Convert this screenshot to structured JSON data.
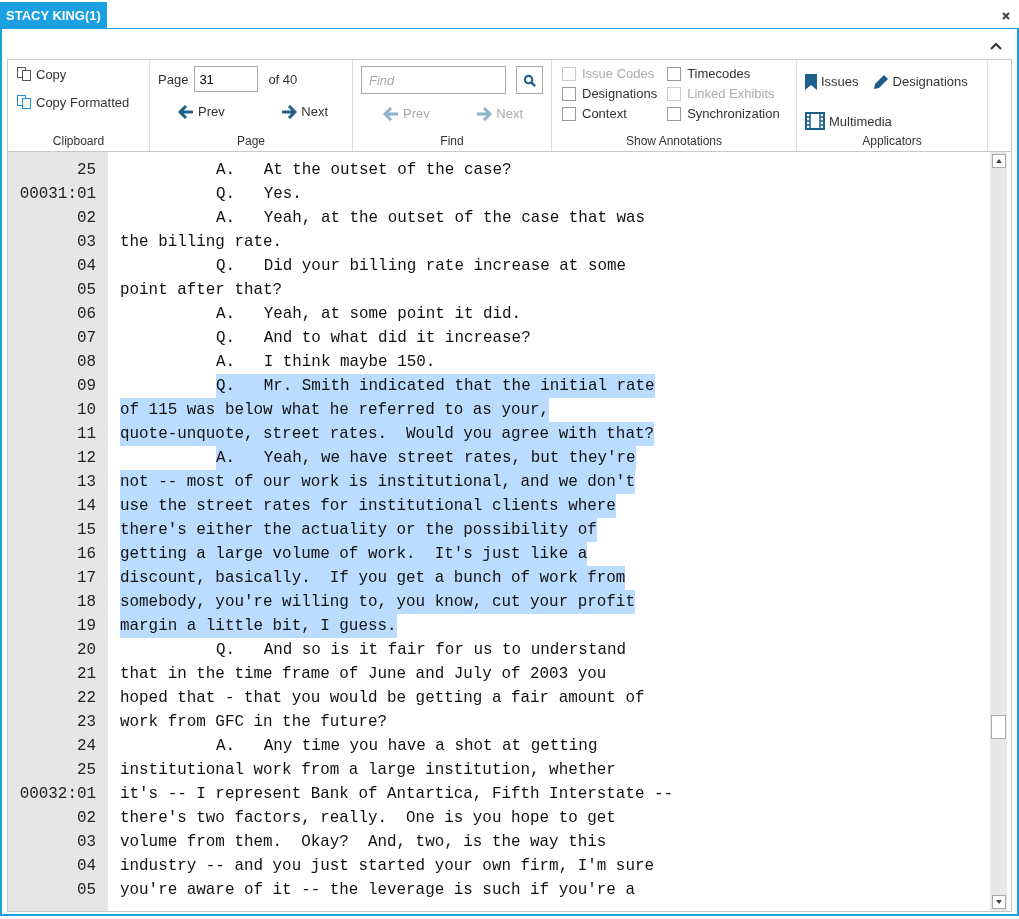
{
  "tab": {
    "label": "STACY KING(1)",
    "selected": true
  },
  "ribbon": {
    "clipboard": {
      "buttons": [
        "Copy",
        "Copy Formatted"
      ],
      "label": "Clipboard"
    },
    "page": {
      "prefix": "Page",
      "value": "31",
      "suffix": "of 40",
      "prev": "Prev",
      "next": "Next",
      "label": "Page"
    },
    "find": {
      "placeholder": "Find",
      "prev": {
        "label": "Prev",
        "disabled": true
      },
      "next": {
        "label": "Next",
        "disabled": true
      },
      "label": "Find"
    },
    "annotations": {
      "label": "Show Annotations",
      "columns": [
        [
          {
            "label": "Issue Codes",
            "checked": false,
            "disabled": true
          },
          {
            "label": "Designations",
            "checked": false,
            "disabled": false
          },
          {
            "label": "Context",
            "checked": false,
            "disabled": false
          }
        ],
        [
          {
            "label": "Timecodes",
            "checked": false,
            "disabled": false
          },
          {
            "label": "Linked Exhibits",
            "checked": false,
            "disabled": true
          },
          {
            "label": "Synchronization",
            "checked": false,
            "disabled": false
          }
        ]
      ]
    },
    "applicators": {
      "label": "Applicators",
      "items": [
        {
          "kind": "issues",
          "label": "Issues"
        },
        {
          "kind": "designations",
          "label": "Designations"
        },
        {
          "kind": "multimedia",
          "label": "Multimedia"
        }
      ]
    }
  },
  "transcript": [
    {
      "number": "25",
      "text": "A.   At the outset of the case?",
      "indented": true,
      "highlighted": false
    },
    {
      "number": "00031:01",
      "text": "Q.   Yes.",
      "indented": true,
      "highlighted": false
    },
    {
      "number": "02",
      "text": "A.   Yeah, at the outset of the case that was",
      "indented": true,
      "highlighted": false
    },
    {
      "number": "03",
      "text": "the billing rate.",
      "indented": false,
      "highlighted": false
    },
    {
      "number": "04",
      "text": "Q.   Did your billing rate increase at some",
      "indented": true,
      "highlighted": false
    },
    {
      "number": "05",
      "text": "point after that?",
      "indented": false,
      "highlighted": false
    },
    {
      "number": "06",
      "text": "A.   Yeah, at some point it did.",
      "indented": true,
      "highlighted": false
    },
    {
      "number": "07",
      "text": "Q.   And to what did it increase?",
      "indented": true,
      "highlighted": false
    },
    {
      "number": "08",
      "text": "A.   I think maybe 150.",
      "indented": true,
      "highlighted": false
    },
    {
      "number": "09",
      "text": "Q.   Mr. Smith indicated that the initial rate",
      "indented": true,
      "highlighted": true
    },
    {
      "number": "10",
      "text": "of 115 was below what he referred to as your,",
      "indented": false,
      "highlighted": true
    },
    {
      "number": "11",
      "text": "quote-unquote, street rates.  Would you agree with that?",
      "indented": false,
      "highlighted": true
    },
    {
      "number": "12",
      "text": "A.   Yeah, we have street rates, but they're",
      "indented": true,
      "highlighted": true
    },
    {
      "number": "13",
      "text": "not -- most of our work is institutional, and we don't",
      "indented": false,
      "highlighted": true
    },
    {
      "number": "14",
      "text": "use the street rates for institutional clients where",
      "indented": false,
      "highlighted": true
    },
    {
      "number": "15",
      "text": "there's either the actuality or the possibility of",
      "indented": false,
      "highlighted": true
    },
    {
      "number": "16",
      "text": "getting a large volume of work.  It's just like a",
      "indented": false,
      "highlighted": true
    },
    {
      "number": "17",
      "text": "discount, basically.  If you get a bunch of work from",
      "indented": false,
      "highlighted": true
    },
    {
      "number": "18",
      "text": "somebody, you're willing to, you know, cut your profit",
      "indented": false,
      "highlighted": true
    },
    {
      "number": "19",
      "text": "margin a little bit, I guess.",
      "indented": false,
      "highlighted": true
    },
    {
      "number": "20",
      "text": "Q.   And so is it fair for us to understand",
      "indented": true,
      "highlighted": false
    },
    {
      "number": "21",
      "text": "that in the time frame of June and July of 2003 you",
      "indented": false,
      "highlighted": false
    },
    {
      "number": "22",
      "text": "hoped that - that you would be getting a fair amount of",
      "indented": false,
      "highlighted": false
    },
    {
      "number": "23",
      "text": "work from GFC in the future?",
      "indented": false,
      "highlighted": false
    },
    {
      "number": "24",
      "text": "A.   Any time you have a shot at getting",
      "indented": true,
      "highlighted": false
    },
    {
      "number": "25",
      "text": "institutional work from a large institution, whether",
      "indented": false,
      "highlighted": false
    },
    {
      "number": "00032:01",
      "text": "it's -- I represent Bank of Antartica, Fifth Interstate --",
      "indented": false,
      "highlighted": false
    },
    {
      "number": "02",
      "text": "there's two factors, really.  One is you hope to get",
      "indented": false,
      "highlighted": false
    },
    {
      "number": "03",
      "text": "volume from them.  Okay?  And, two, is the way this",
      "indented": false,
      "highlighted": false
    },
    {
      "number": "04",
      "text": "industry -- and you just started your own firm, I'm sure",
      "indented": false,
      "highlighted": false
    },
    {
      "number": "05",
      "text": "you're aware of it -- the leverage is such if you're a",
      "indented": false,
      "highlighted": false
    }
  ]
}
